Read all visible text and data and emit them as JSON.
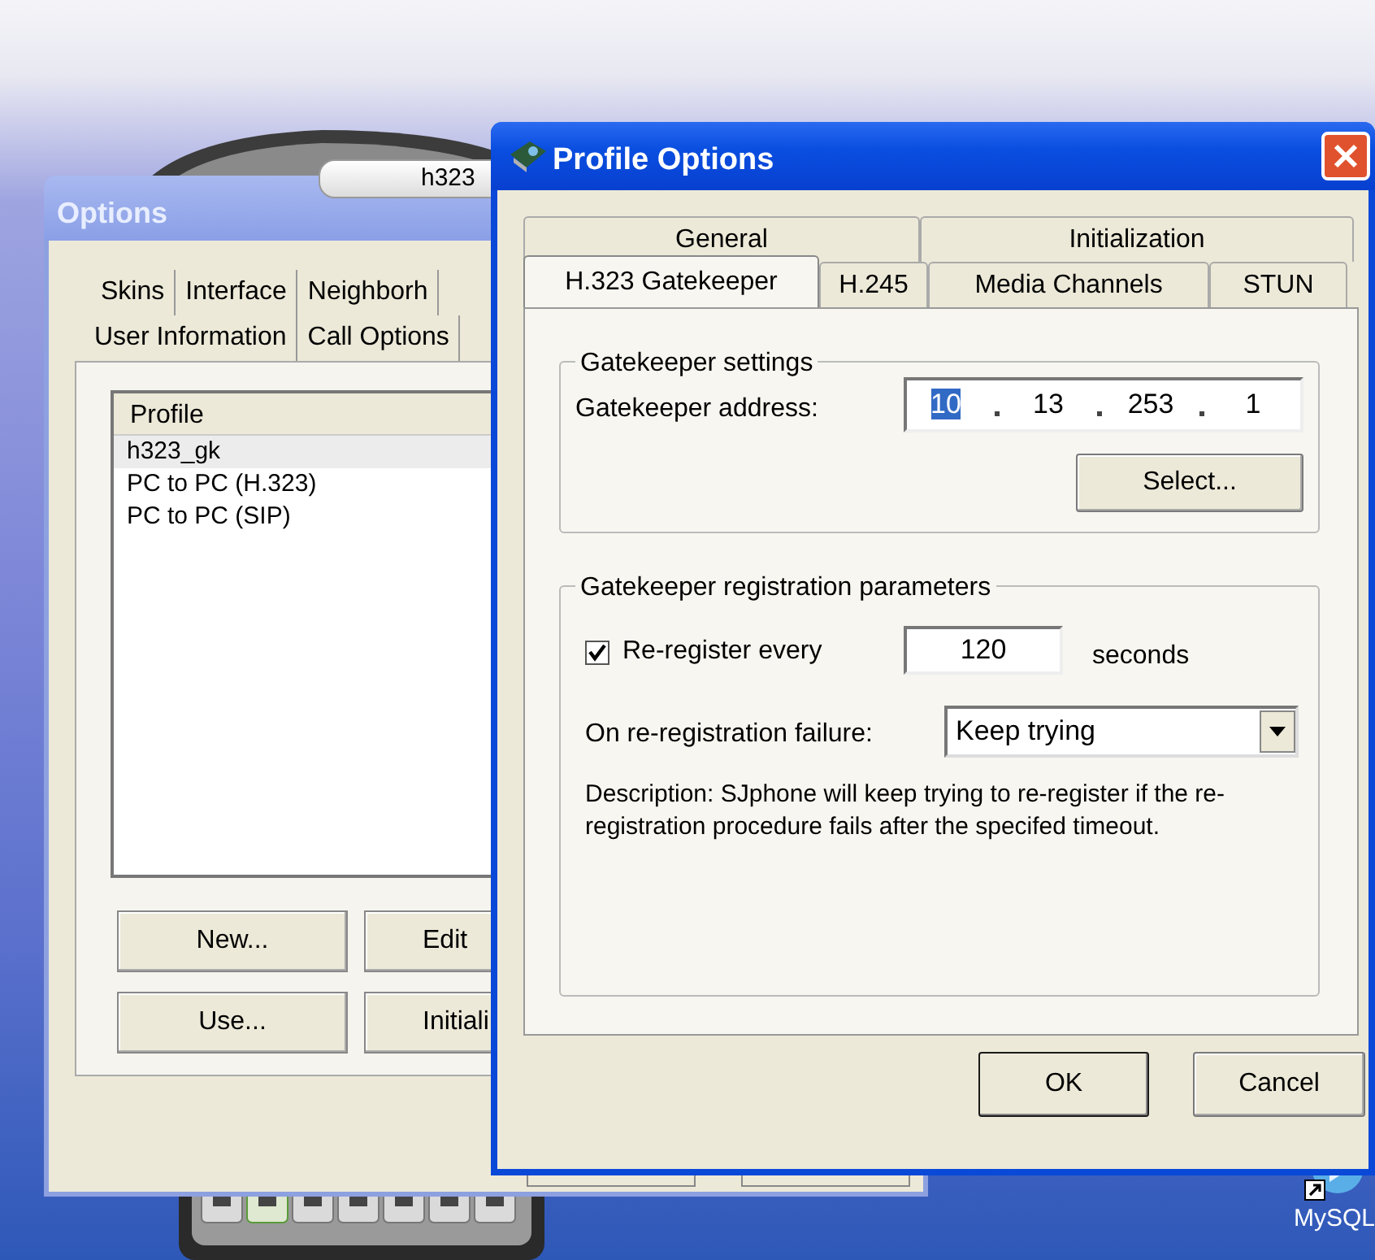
{
  "phone": {
    "display": "h323"
  },
  "options_window": {
    "title": "Options",
    "tab_rows": [
      [
        "Skins",
        "Interface",
        "Neighborh"
      ],
      [
        "User Information",
        "Call Options"
      ]
    ],
    "list": {
      "header": "Profile",
      "items": [
        {
          "label": "h323_gk",
          "selected": true
        },
        {
          "label": "PC to PC (H.323)",
          "selected": false
        },
        {
          "label": "PC to PC (SIP)",
          "selected": false
        }
      ]
    },
    "buttons": [
      [
        "New...",
        "Edit"
      ],
      [
        "Use...",
        "Initiali"
      ]
    ]
  },
  "profile_dialog": {
    "title": "Profile Options",
    "tab_rows": [
      [
        {
          "label": "General",
          "selected": false
        },
        {
          "label": "Initialization",
          "selected": false
        }
      ],
      [
        {
          "label": "H.323 Gatekeeper",
          "selected": true
        },
        {
          "label": "H.245",
          "selected": false
        },
        {
          "label": "Media Channels",
          "selected": false
        },
        {
          "label": "STUN",
          "selected": false
        }
      ]
    ],
    "gatekeeper_settings": {
      "legend": "Gatekeeper settings",
      "address_label": "Gatekeeper address:",
      "address": [
        {
          "value": "10",
          "selected": true
        },
        {
          "value": "13",
          "selected": false
        },
        {
          "value": "253",
          "selected": false
        },
        {
          "value": "1",
          "selected": false
        }
      ],
      "select_button": "Select..."
    },
    "registration": {
      "legend": "Gatekeeper registration parameters",
      "reregister": {
        "label": "Re-register every",
        "checked": true
      },
      "interval": "120",
      "unit": "seconds",
      "failure_label": "On re-registration failure:",
      "failure_value": "Keep trying",
      "description": "Description: SJphone will keep trying to re-register if the re-registration procedure fails after the specifed timeout."
    },
    "buttons": [
      {
        "label": "OK",
        "default": true
      },
      {
        "label": "Cancel",
        "default": false
      }
    ]
  },
  "desktop_icon": {
    "label": "MySQL"
  }
}
